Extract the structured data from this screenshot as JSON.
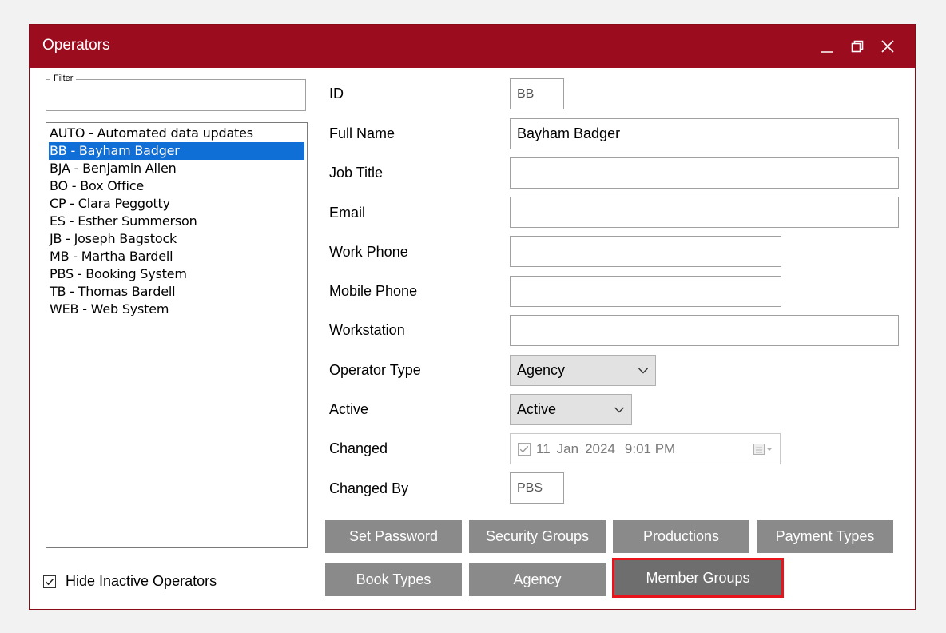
{
  "window": {
    "title": "Operators"
  },
  "filter": {
    "legend": "Filter",
    "value": ""
  },
  "operators": [
    {
      "label": "AUTO - Automated data updates",
      "selected": false
    },
    {
      "label": "BB - Bayham Badger",
      "selected": true
    },
    {
      "label": "BJA - Benjamin Allen",
      "selected": false
    },
    {
      "label": "BO - Box Office",
      "selected": false
    },
    {
      "label": "CP - Clara Peggotty",
      "selected": false
    },
    {
      "label": "ES - Esther Summerson",
      "selected": false
    },
    {
      "label": "JB - Joseph Bagstock",
      "selected": false
    },
    {
      "label": "MB - Martha Bardell",
      "selected": false
    },
    {
      "label": "PBS - Booking System",
      "selected": false
    },
    {
      "label": "TB - Thomas Bardell",
      "selected": false
    },
    {
      "label": "WEB - Web System",
      "selected": false
    }
  ],
  "hide_inactive": {
    "label": "Hide Inactive Operators",
    "checked": true
  },
  "form": {
    "id": {
      "label": "ID",
      "value": "BB"
    },
    "full_name": {
      "label": "Full Name",
      "value": "Bayham Badger"
    },
    "job_title": {
      "label": "Job Title",
      "value": ""
    },
    "email": {
      "label": "Email",
      "value": ""
    },
    "work_phone": {
      "label": "Work Phone",
      "value": ""
    },
    "mobile_phone": {
      "label": "Mobile Phone",
      "value": ""
    },
    "workstation": {
      "label": "Workstation",
      "value": ""
    },
    "operator_type": {
      "label": "Operator Type",
      "value": "Agency"
    },
    "active": {
      "label": "Active",
      "value": "Active"
    },
    "changed": {
      "label": "Changed",
      "day": "11",
      "month": "Jan",
      "year": "2024",
      "time": "9:01 PM",
      "checked": true
    },
    "changed_by": {
      "label": "Changed By",
      "value": "PBS"
    }
  },
  "buttons": {
    "set_password": "Set Password",
    "security_groups": "Security Groups",
    "productions": "Productions",
    "payment_types": "Payment Types",
    "book_types": "Book Types",
    "agency": "Agency",
    "member_groups": "Member Groups"
  },
  "colors": {
    "titlebar": "#9b0c1f",
    "selection": "#0f6fd6",
    "button": "#8a8a8a",
    "highlight": "#e8141c"
  }
}
